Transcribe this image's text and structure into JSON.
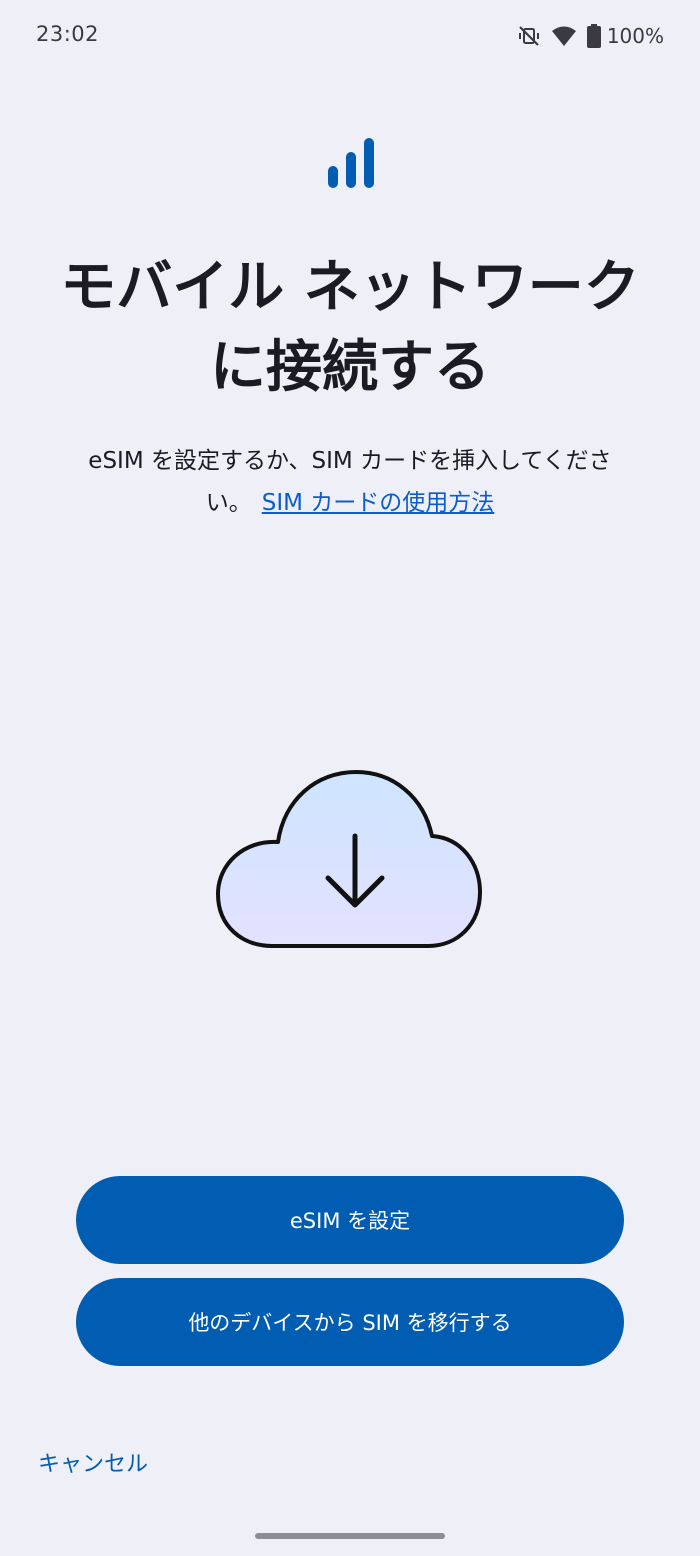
{
  "status_bar": {
    "time": "23:02",
    "battery": "100%",
    "icons": [
      "mute-vibrate-icon",
      "wifi-icon",
      "battery-icon"
    ]
  },
  "header": {
    "icon": "signal-bars-icon",
    "title": "モバイル ネットワークに接続する"
  },
  "body": {
    "description": "eSIM を設定するか、SIM カードを挿入してください。",
    "help_link": "SIM カードの使用方法",
    "illustration": "cloud-download-icon"
  },
  "actions": {
    "setup_esim": "eSIM を設定",
    "transfer_sim": "他のデバイスから SIM を移行する",
    "cancel": "キャンセル"
  },
  "colors": {
    "background": "#eff0f7",
    "primary": "#005db2",
    "link": "#0b5cd0",
    "text": "#1b1b21"
  }
}
